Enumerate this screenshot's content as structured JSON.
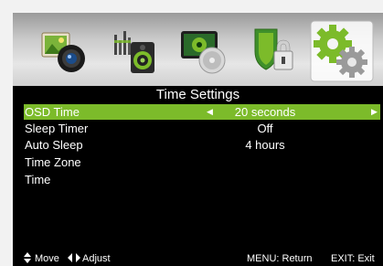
{
  "menu": {
    "icons": [
      {
        "name": "picture-icon"
      },
      {
        "name": "sound-icon"
      },
      {
        "name": "channel-icon"
      },
      {
        "name": "lock-icon"
      },
      {
        "name": "settings-gear-icon",
        "selected": true
      }
    ],
    "accent_color": "#7cbb2a"
  },
  "section": {
    "title": "Time Settings"
  },
  "items": [
    {
      "label": "OSD Time",
      "value": "20 seconds",
      "selected": true
    },
    {
      "label": "Sleep Timer",
      "value": "Off"
    },
    {
      "label": "Auto Sleep",
      "value": "4 hours"
    },
    {
      "label": "Time Zone",
      "value": ""
    },
    {
      "label": "Time",
      "value": ""
    }
  ],
  "footer": {
    "move": "Move",
    "adjust": "Adjust",
    "menu_return": "MENU: Return",
    "exit": "EXIT: Exit"
  }
}
